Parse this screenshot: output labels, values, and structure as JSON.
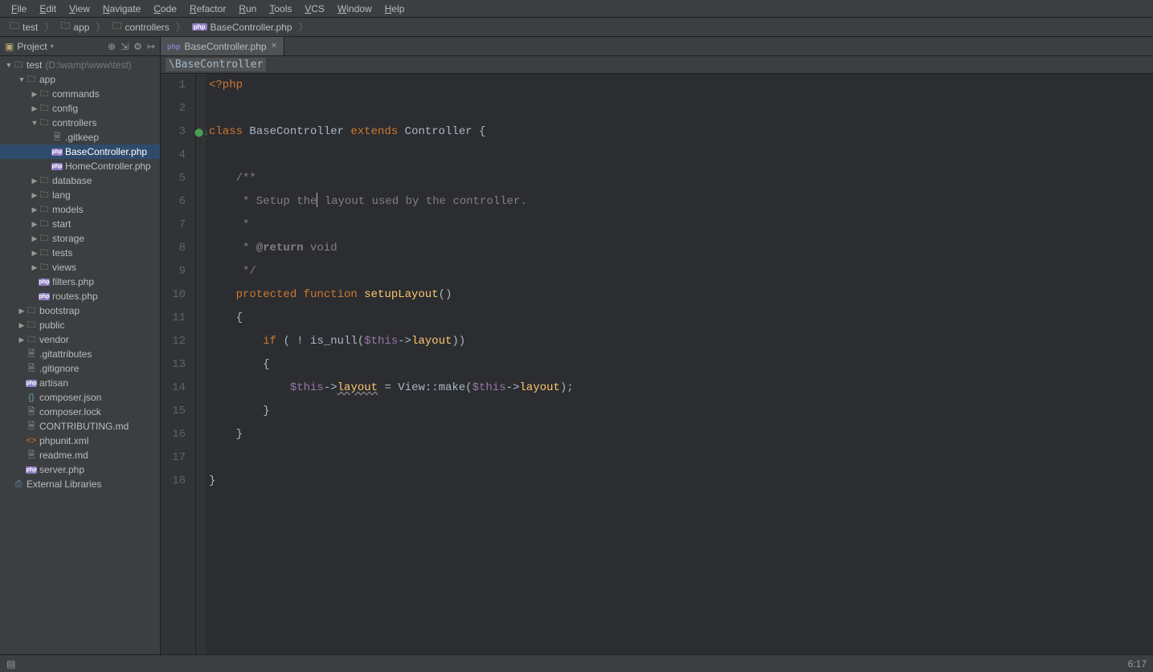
{
  "menubar": [
    "File",
    "Edit",
    "View",
    "Navigate",
    "Code",
    "Refactor",
    "Run",
    "Tools",
    "VCS",
    "Window",
    "Help"
  ],
  "breadcrumb": [
    {
      "icon": "folder",
      "label": "test"
    },
    {
      "icon": "folder",
      "label": "app"
    },
    {
      "icon": "folder",
      "label": "controllers"
    },
    {
      "icon": "php",
      "label": "BaseController.php"
    }
  ],
  "sidebar": {
    "title": "Project"
  },
  "tree": [
    {
      "d": 0,
      "a": "d",
      "i": "folder",
      "l": "test",
      "h": "(D:\\wamp\\www\\test)"
    },
    {
      "d": 1,
      "a": "d",
      "i": "folder",
      "l": "app"
    },
    {
      "d": 2,
      "a": "r",
      "i": "folder",
      "l": "commands"
    },
    {
      "d": 2,
      "a": "r",
      "i": "folder",
      "l": "config"
    },
    {
      "d": 2,
      "a": "d",
      "i": "folder",
      "l": "controllers"
    },
    {
      "d": 3,
      "a": "",
      "i": "file",
      "l": ".gitkeep"
    },
    {
      "d": 3,
      "a": "",
      "i": "php",
      "l": "BaseController.php",
      "sel": true
    },
    {
      "d": 3,
      "a": "",
      "i": "php",
      "l": "HomeController.php"
    },
    {
      "d": 2,
      "a": "r",
      "i": "folder",
      "l": "database"
    },
    {
      "d": 2,
      "a": "r",
      "i": "folder",
      "l": "lang"
    },
    {
      "d": 2,
      "a": "r",
      "i": "folder",
      "l": "models"
    },
    {
      "d": 2,
      "a": "r",
      "i": "folder",
      "l": "start"
    },
    {
      "d": 2,
      "a": "r",
      "i": "folder",
      "l": "storage"
    },
    {
      "d": 2,
      "a": "r",
      "i": "folder",
      "l": "tests"
    },
    {
      "d": 2,
      "a": "r",
      "i": "folder",
      "l": "views"
    },
    {
      "d": 2,
      "a": "",
      "i": "php",
      "l": "filters.php"
    },
    {
      "d": 2,
      "a": "",
      "i": "php",
      "l": "routes.php"
    },
    {
      "d": 1,
      "a": "r",
      "i": "folder",
      "l": "bootstrap"
    },
    {
      "d": 1,
      "a": "r",
      "i": "folder",
      "l": "public"
    },
    {
      "d": 1,
      "a": "r",
      "i": "folder",
      "l": "vendor"
    },
    {
      "d": 1,
      "a": "",
      "i": "file",
      "l": ".gitattributes"
    },
    {
      "d": 1,
      "a": "",
      "i": "file",
      "l": ".gitignore"
    },
    {
      "d": 1,
      "a": "",
      "i": "php",
      "l": "artisan"
    },
    {
      "d": 1,
      "a": "",
      "i": "json",
      "l": "composer.json"
    },
    {
      "d": 1,
      "a": "",
      "i": "file",
      "l": "composer.lock"
    },
    {
      "d": 1,
      "a": "",
      "i": "md",
      "l": "CONTRIBUTING.md"
    },
    {
      "d": 1,
      "a": "",
      "i": "xml",
      "l": "phpunit.xml"
    },
    {
      "d": 1,
      "a": "",
      "i": "md",
      "l": "readme.md"
    },
    {
      "d": 1,
      "a": "",
      "i": "php",
      "l": "server.php"
    },
    {
      "d": 0,
      "a": "",
      "i": "lib",
      "l": "External Libraries"
    }
  ],
  "tab": {
    "label": "BaseController.php"
  },
  "context": "\\BaseController",
  "code_lines": [
    [
      {
        "c": "kw",
        "t": "<?php"
      }
    ],
    [],
    [
      {
        "c": "kw",
        "t": "class "
      },
      {
        "c": "type",
        "t": "BaseController "
      },
      {
        "c": "kw",
        "t": "extends "
      },
      {
        "c": "type",
        "t": "Controller "
      },
      {
        "c": "pln",
        "t": "{"
      }
    ],
    [],
    [
      {
        "c": "cmt",
        "t": "    /**"
      }
    ],
    [
      {
        "c": "cmt",
        "t": "     * Setup the"
      },
      {
        "c": "cursor",
        "t": ""
      },
      {
        "c": "cmt",
        "t": " layout used by the controller."
      }
    ],
    [
      {
        "c": "cmt",
        "t": "     *"
      }
    ],
    [
      {
        "c": "cmt",
        "t": "     * "
      },
      {
        "c": "ann",
        "t": "@return "
      },
      {
        "c": "ann2",
        "t": "void"
      }
    ],
    [
      {
        "c": "cmt",
        "t": "     */"
      }
    ],
    [
      {
        "c": "pln",
        "t": "    "
      },
      {
        "c": "kw",
        "t": "protected function "
      },
      {
        "c": "fn",
        "t": "setupLayout"
      },
      {
        "c": "pln",
        "t": "()"
      }
    ],
    [
      {
        "c": "pln",
        "t": "    {"
      }
    ],
    [
      {
        "c": "pln",
        "t": "        "
      },
      {
        "c": "kw",
        "t": "if "
      },
      {
        "c": "pln",
        "t": "( ! is_null("
      },
      {
        "c": "var",
        "t": "$this"
      },
      {
        "c": "pln",
        "t": "->"
      },
      {
        "c": "prop",
        "t": "layout"
      },
      {
        "c": "pln",
        "t": "))"
      }
    ],
    [
      {
        "c": "pln",
        "t": "        {"
      }
    ],
    [
      {
        "c": "pln",
        "t": "            "
      },
      {
        "c": "var",
        "t": "$this"
      },
      {
        "c": "pln",
        "t": "->"
      },
      {
        "c": "prop under",
        "t": "layout"
      },
      {
        "c": "pln",
        "t": " = View::make("
      },
      {
        "c": "var",
        "t": "$this"
      },
      {
        "c": "pln",
        "t": "->"
      },
      {
        "c": "prop",
        "t": "layout"
      },
      {
        "c": "pln",
        "t": ");"
      }
    ],
    [
      {
        "c": "pln",
        "t": "        }"
      }
    ],
    [
      {
        "c": "pln",
        "t": "    }"
      }
    ],
    [],
    [
      {
        "c": "pln",
        "t": "}"
      }
    ]
  ],
  "status": {
    "pos": "6:17"
  }
}
